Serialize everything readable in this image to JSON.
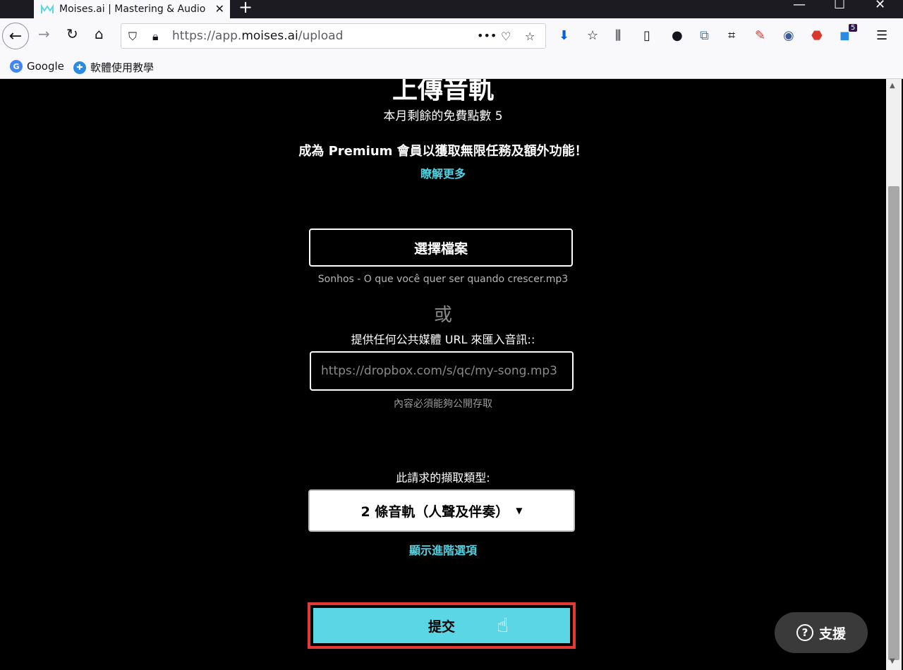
{
  "browser": {
    "tab_title": "Moises.ai | Mastering & Audio",
    "tab_close": "✕",
    "new_tab": "+",
    "url_prefix": "https://app.",
    "url_domain": "moises.ai",
    "url_path": "/upload",
    "url_more": "•••",
    "extension_badge": "5",
    "bookmarks": [
      {
        "label": "Google",
        "icon": "google-icon"
      },
      {
        "label": "軟體使用教學",
        "icon": "tutorial-icon"
      }
    ]
  },
  "page": {
    "title": "上傳音軌",
    "credits": "本月剩餘的免費點數 5",
    "promo": "成為 Premium 會員以獲取無限任務及額外功能！",
    "learn_more": "瞭解更多",
    "choose_file": "選擇檔案",
    "file_name": "Sonhos - O que você quer ser quando crescer.mp3",
    "or": "或",
    "url_label": "提供任何公共媒體 URL 來匯入音訊::",
    "url_placeholder": "https://dropbox.com/s/qc/my-song.mp3",
    "url_hint": "內容必須能夠公開存取",
    "separation_label": "此請求的擷取類型:",
    "separation_value": "2 條音軌（人聲及伴奏）",
    "advanced": "顯示進階選項",
    "submit": "提交",
    "support": "支援"
  },
  "colors": {
    "accent": "#5bd6e4",
    "link": "#4fd1e0",
    "highlight_border": "#e53935",
    "background": "#000000"
  }
}
